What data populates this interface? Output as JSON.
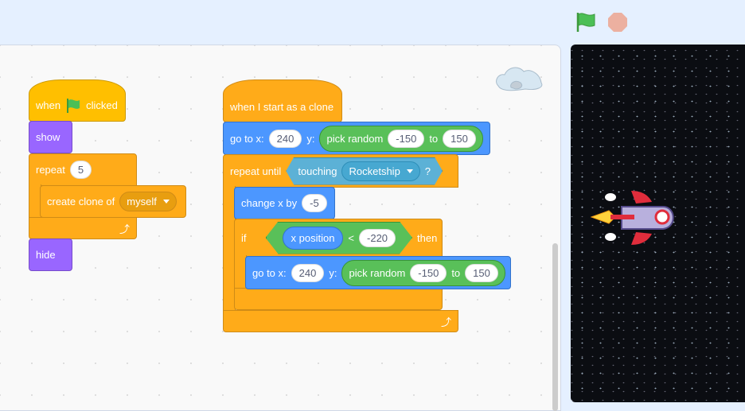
{
  "toolbar": {
    "green_flag": "green-flag-icon",
    "stop": "stop-icon"
  },
  "colors": {
    "events": "#ffbf00",
    "looks": "#9966ff",
    "control": "#ffab19",
    "motion": "#4c97ff",
    "operators": "#59c059",
    "sensing": "#5cb1d6"
  },
  "script1": {
    "hat": {
      "when": "when",
      "clicked": "clicked"
    },
    "show": "show",
    "repeat": {
      "label": "repeat",
      "times": "5"
    },
    "create_clone": {
      "label": "create clone of",
      "target": "myself"
    },
    "hide": "hide"
  },
  "script2": {
    "hat": "when I start as a clone",
    "goto1": {
      "label": "go to x:",
      "x": "240",
      "y_label": "y:",
      "random": "pick random",
      "from": "-150",
      "to_label": "to",
      "to": "150"
    },
    "repeat_until": {
      "label": "repeat until",
      "touching": "touching",
      "target": "Rocketship",
      "q": "?"
    },
    "change_x": {
      "label": "change x by",
      "value": "-5"
    },
    "if": {
      "label": "if",
      "reporter": "x position",
      "op": "<",
      "value": "-220",
      "then": "then"
    },
    "goto2": {
      "label": "go to x:",
      "x": "240",
      "y_label": "y:",
      "random": "pick random",
      "from": "-150",
      "to_label": "to",
      "to": "150"
    }
  }
}
